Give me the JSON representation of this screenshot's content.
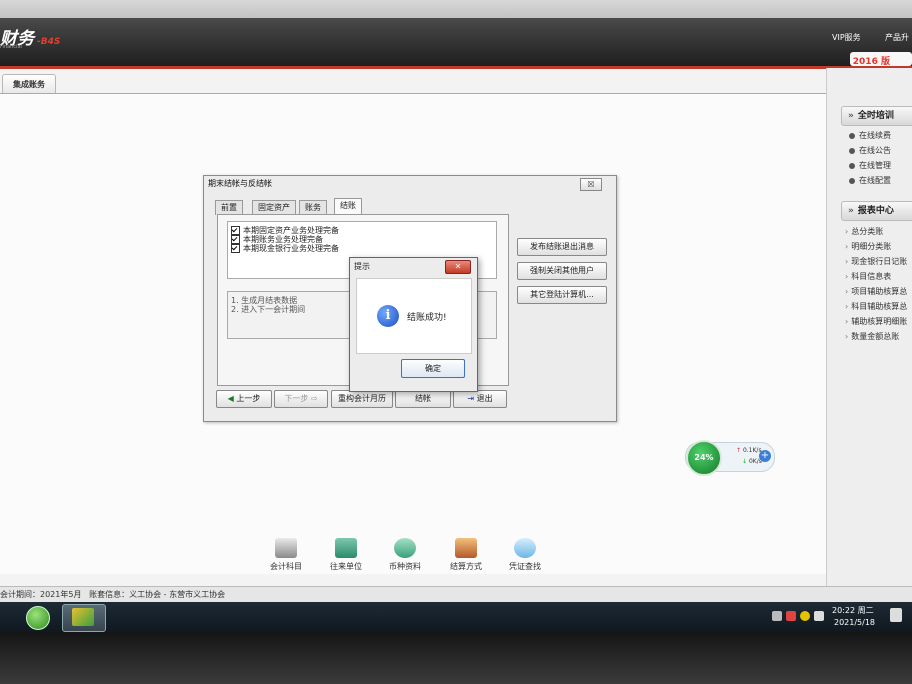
{
  "app": {
    "logo_text": "财务",
    "logo_version": "-B4S",
    "logo_sub": "Financial",
    "top_links": [
      "VIP服务",
      "产品升"
    ],
    "year": "2016",
    "year_suffix": "版"
  },
  "tab": {
    "label": "集成账务"
  },
  "right_panel": {
    "section1_title": "全时培训",
    "section1_items": [
      "在线续费",
      "在线公告",
      "在线管理",
      "在线配置"
    ],
    "section2_title": "报表中心",
    "section2_items": [
      "总分类账",
      "明细分类账",
      "现金银行日记账",
      "科目信息表",
      "项目辅助核算总",
      "科目辅助核算总",
      "辅助核算明细账",
      "数量金额总账"
    ]
  },
  "dialog": {
    "title": "期末结帐与反结帐",
    "close_label": "☒",
    "tabs": [
      "前置",
      "固定资产",
      "账务",
      "结账"
    ],
    "checklist": [
      "本期固定资产业务处理完备",
      "本期账务业务处理完备",
      "本期现金银行业务处理完备"
    ],
    "notes": [
      "1. 生成月结表数据",
      "2. 进入下一会计期间"
    ],
    "side_buttons": [
      "发布结账退出消息",
      "强制关闭其他用户",
      "其它登陆计算机..."
    ],
    "nav_buttons": {
      "prev": "上一步",
      "next": "下一步",
      "rebuild": "重构会计月历",
      "close_period": "结帐",
      "exit": "退出"
    }
  },
  "message_box": {
    "title": "提示",
    "text": "结账成功!",
    "ok": "确定"
  },
  "net_widget": {
    "percent": "24%",
    "up": "0.1K/s",
    "down": "0K/s"
  },
  "toolbar": [
    "会计科目",
    "往来单位",
    "币种资料",
    "结算方式",
    "凭证查找"
  ],
  "status_bar": {
    "period": "会计期间：2021年5月",
    "set_info": "账套信息：义工协会 - 东营市义工协会"
  },
  "taskbar": {
    "time": "20:22 周二",
    "date": "2021/5/18"
  }
}
